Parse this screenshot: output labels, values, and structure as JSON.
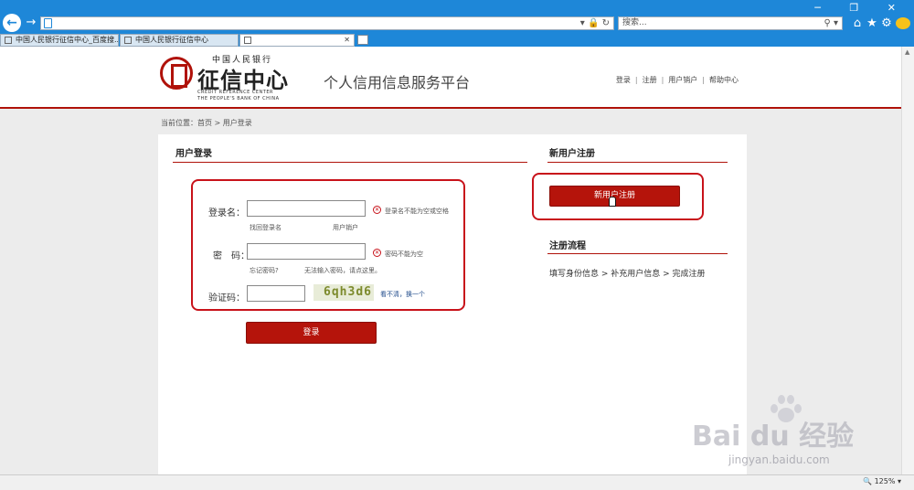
{
  "browser": {
    "search_placeholder": "搜索...",
    "window_controls": "─ ❐ ✕",
    "tabs": [
      {
        "label": "中国人民银行征信中心_百度搜..."
      },
      {
        "label": "中国人民银行征信中心"
      },
      {
        "label": ""
      }
    ],
    "zoom": "125%"
  },
  "header": {
    "logo_top": "中国人民银行",
    "logo_main": "征信中心",
    "logo_en_line1": "CREDIT REFERENCE CENTER",
    "logo_en_line2": "THE PEOPLE'S BANK OF CHINA",
    "platform_title": "个人信用信息服务平台",
    "nav": [
      {
        "label": "登录"
      },
      {
        "label": "注册"
      },
      {
        "label": "用户销户"
      },
      {
        "label": "帮助中心"
      }
    ]
  },
  "breadcrumb": "当前位置：首页 > 用户登录",
  "login": {
    "title": "用户登录",
    "username_label": "登录名：",
    "username_error": "登录名不能为空或空格",
    "find_username": "找回登录名",
    "cancel_account": "用户销户",
    "password_label": "密　码：",
    "password_error": "密码不能为空",
    "forgot_password": "忘记密码?",
    "cannot_input": "无法输入密码，请点这里。",
    "captcha_label": "验证码：",
    "captcha_text": "6qh3d6",
    "captcha_refresh": "看不清，换一个",
    "submit_label": "登录"
  },
  "register": {
    "title": "新用户注册",
    "button_label": "新用户注册",
    "flow_title": "注册流程",
    "flow_text": "填写身份信息 > 补充用户信息 > 完成注册"
  },
  "watermark": {
    "text": "Bai du 经验",
    "sub": "jingyan.baidu.com"
  },
  "colors": {
    "accent": "#b5140b",
    "highlight": "#c8121a",
    "browser_blue": "#1e87d8"
  }
}
